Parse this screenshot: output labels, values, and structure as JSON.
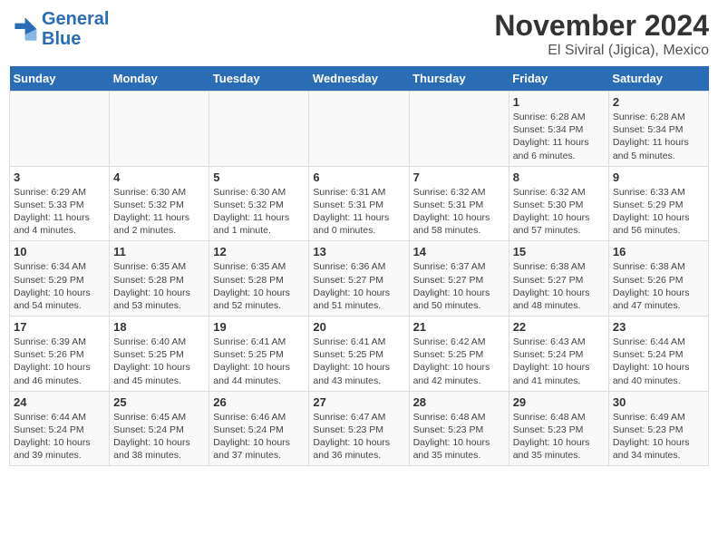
{
  "logo": {
    "line1": "General",
    "line2": "Blue"
  },
  "title": "November 2024",
  "subtitle": "El Siviral (Jigica), Mexico",
  "days_of_week": [
    "Sunday",
    "Monday",
    "Tuesday",
    "Wednesday",
    "Thursday",
    "Friday",
    "Saturday"
  ],
  "weeks": [
    [
      {
        "day": "",
        "info": ""
      },
      {
        "day": "",
        "info": ""
      },
      {
        "day": "",
        "info": ""
      },
      {
        "day": "",
        "info": ""
      },
      {
        "day": "",
        "info": ""
      },
      {
        "day": "1",
        "info": "Sunrise: 6:28 AM\nSunset: 5:34 PM\nDaylight: 11 hours and 6 minutes."
      },
      {
        "day": "2",
        "info": "Sunrise: 6:28 AM\nSunset: 5:34 PM\nDaylight: 11 hours and 5 minutes."
      }
    ],
    [
      {
        "day": "3",
        "info": "Sunrise: 6:29 AM\nSunset: 5:33 PM\nDaylight: 11 hours and 4 minutes."
      },
      {
        "day": "4",
        "info": "Sunrise: 6:30 AM\nSunset: 5:32 PM\nDaylight: 11 hours and 2 minutes."
      },
      {
        "day": "5",
        "info": "Sunrise: 6:30 AM\nSunset: 5:32 PM\nDaylight: 11 hours and 1 minute."
      },
      {
        "day": "6",
        "info": "Sunrise: 6:31 AM\nSunset: 5:31 PM\nDaylight: 11 hours and 0 minutes."
      },
      {
        "day": "7",
        "info": "Sunrise: 6:32 AM\nSunset: 5:31 PM\nDaylight: 10 hours and 58 minutes."
      },
      {
        "day": "8",
        "info": "Sunrise: 6:32 AM\nSunset: 5:30 PM\nDaylight: 10 hours and 57 minutes."
      },
      {
        "day": "9",
        "info": "Sunrise: 6:33 AM\nSunset: 5:29 PM\nDaylight: 10 hours and 56 minutes."
      }
    ],
    [
      {
        "day": "10",
        "info": "Sunrise: 6:34 AM\nSunset: 5:29 PM\nDaylight: 10 hours and 54 minutes."
      },
      {
        "day": "11",
        "info": "Sunrise: 6:35 AM\nSunset: 5:28 PM\nDaylight: 10 hours and 53 minutes."
      },
      {
        "day": "12",
        "info": "Sunrise: 6:35 AM\nSunset: 5:28 PM\nDaylight: 10 hours and 52 minutes."
      },
      {
        "day": "13",
        "info": "Sunrise: 6:36 AM\nSunset: 5:27 PM\nDaylight: 10 hours and 51 minutes."
      },
      {
        "day": "14",
        "info": "Sunrise: 6:37 AM\nSunset: 5:27 PM\nDaylight: 10 hours and 50 minutes."
      },
      {
        "day": "15",
        "info": "Sunrise: 6:38 AM\nSunset: 5:27 PM\nDaylight: 10 hours and 48 minutes."
      },
      {
        "day": "16",
        "info": "Sunrise: 6:38 AM\nSunset: 5:26 PM\nDaylight: 10 hours and 47 minutes."
      }
    ],
    [
      {
        "day": "17",
        "info": "Sunrise: 6:39 AM\nSunset: 5:26 PM\nDaylight: 10 hours and 46 minutes."
      },
      {
        "day": "18",
        "info": "Sunrise: 6:40 AM\nSunset: 5:25 PM\nDaylight: 10 hours and 45 minutes."
      },
      {
        "day": "19",
        "info": "Sunrise: 6:41 AM\nSunset: 5:25 PM\nDaylight: 10 hours and 44 minutes."
      },
      {
        "day": "20",
        "info": "Sunrise: 6:41 AM\nSunset: 5:25 PM\nDaylight: 10 hours and 43 minutes."
      },
      {
        "day": "21",
        "info": "Sunrise: 6:42 AM\nSunset: 5:25 PM\nDaylight: 10 hours and 42 minutes."
      },
      {
        "day": "22",
        "info": "Sunrise: 6:43 AM\nSunset: 5:24 PM\nDaylight: 10 hours and 41 minutes."
      },
      {
        "day": "23",
        "info": "Sunrise: 6:44 AM\nSunset: 5:24 PM\nDaylight: 10 hours and 40 minutes."
      }
    ],
    [
      {
        "day": "24",
        "info": "Sunrise: 6:44 AM\nSunset: 5:24 PM\nDaylight: 10 hours and 39 minutes."
      },
      {
        "day": "25",
        "info": "Sunrise: 6:45 AM\nSunset: 5:24 PM\nDaylight: 10 hours and 38 minutes."
      },
      {
        "day": "26",
        "info": "Sunrise: 6:46 AM\nSunset: 5:24 PM\nDaylight: 10 hours and 37 minutes."
      },
      {
        "day": "27",
        "info": "Sunrise: 6:47 AM\nSunset: 5:23 PM\nDaylight: 10 hours and 36 minutes."
      },
      {
        "day": "28",
        "info": "Sunrise: 6:48 AM\nSunset: 5:23 PM\nDaylight: 10 hours and 35 minutes."
      },
      {
        "day": "29",
        "info": "Sunrise: 6:48 AM\nSunset: 5:23 PM\nDaylight: 10 hours and 35 minutes."
      },
      {
        "day": "30",
        "info": "Sunrise: 6:49 AM\nSunset: 5:23 PM\nDaylight: 10 hours and 34 minutes."
      }
    ]
  ]
}
